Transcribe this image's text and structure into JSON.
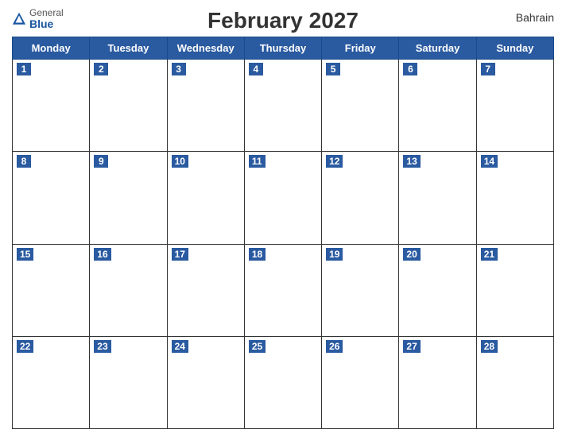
{
  "header": {
    "title": "February 2027",
    "country": "Bahrain",
    "logo_general": "General",
    "logo_blue": "Blue"
  },
  "weekdays": [
    "Monday",
    "Tuesday",
    "Wednesday",
    "Thursday",
    "Friday",
    "Saturday",
    "Sunday"
  ],
  "weeks": [
    [
      1,
      2,
      3,
      4,
      5,
      6,
      7
    ],
    [
      8,
      9,
      10,
      11,
      12,
      13,
      14
    ],
    [
      15,
      16,
      17,
      18,
      19,
      20,
      21
    ],
    [
      22,
      23,
      24,
      25,
      26,
      27,
      28
    ]
  ]
}
